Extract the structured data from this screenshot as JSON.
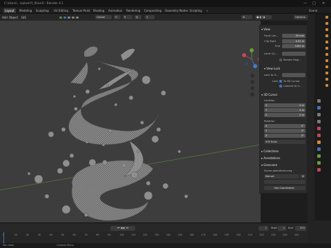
{
  "window": {
    "title": "C:\\Users\\...\\splash\\Y_Shard] - Blender 4.1",
    "controls": [
      "—",
      "□",
      "✕"
    ]
  },
  "workspace_tabs": [
    "Layout",
    "Modeling",
    "Sculpting",
    "UV Editing",
    "Texture Paint",
    "Shading",
    "Animation",
    "Rendering",
    "Compositing",
    "Geometry Nodes",
    "Scripting"
  ],
  "active_tab": "Layout",
  "scene_label": "Scene",
  "header": {
    "menus": [
      "Add",
      "Object",
      "GIS"
    ],
    "transform": "Global",
    "options": "Options"
  },
  "npanel": {
    "view_section": "View",
    "focal_length_label": "Focal Len...",
    "focal_length": "50 mm",
    "clip_start_label": "Clip Start",
    "clip_start": "0.01 m",
    "clip_end_label": "End",
    "clip_end": "1000 m",
    "local_camera_label": "Local Ca...",
    "render_region_label": "Render Regi...",
    "view_lock_section": "View Lock",
    "lock_object_label": "Lock to O...",
    "lock_label": "Lock",
    "to_3d_cursor": "To 3D Cursor",
    "camera_to_view": "Camera to V...",
    "cursor_section": "3D Cursor",
    "location_label": "Location",
    "loc": [
      {
        "axis": "X",
        "val": "0 m"
      },
      {
        "axis": "Y",
        "val": "0 m"
      },
      {
        "axis": "Z",
        "val": "0 m"
      }
    ],
    "rotation_label": "Rotation",
    "rot": [
      {
        "axis": "X",
        "val": "0°"
      },
      {
        "axis": "Y",
        "val": "0°"
      },
      {
        "axis": "Z",
        "val": "0°"
      }
    ],
    "rotation_mode": "XYZ Euler",
    "collections": "Collections",
    "annotations": "Annotations",
    "geoscene": "Geoscene",
    "scene_georef_label": "Scene georeferencing :",
    "crs": "Not set",
    "geo_origin_label": "Geo Coordinates",
    "col_label": "Col"
  },
  "timeline": {
    "frame_labels": [
      "0",
      "10",
      "20",
      "30",
      "40",
      "50",
      "60",
      "70",
      "80",
      "90",
      "100",
      "110",
      "120",
      "130",
      "140",
      "150",
      "160",
      "170",
      "180",
      "190",
      "200",
      "210",
      "220",
      "230",
      "240",
      "250"
    ],
    "current_frame": "1",
    "start_label": "Start",
    "start": "1",
    "end_label": "End",
    "end": "250"
  },
  "status": {
    "left": "Pan View",
    "middle": "Context Menu"
  },
  "colors": {
    "viewport_bg": "#3d3d3d",
    "accent": "#4772b3",
    "mesh": "#9a9a9a"
  }
}
